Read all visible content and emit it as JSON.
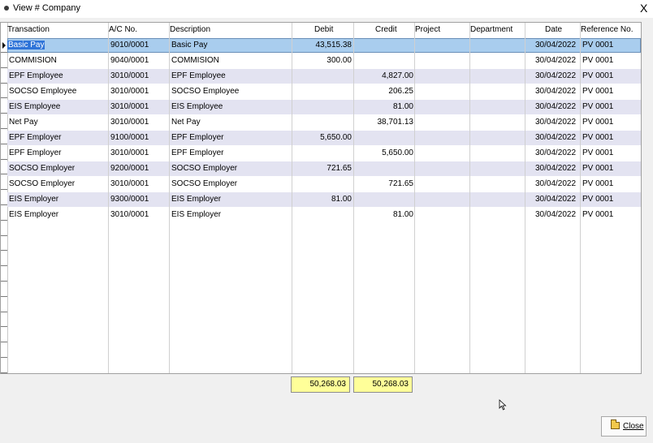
{
  "window": {
    "title": "View # Company",
    "close_glyph": "X"
  },
  "table": {
    "columns": [
      "Transaction",
      "A/C No.",
      "Description",
      "Debit",
      "Credit",
      "Project",
      "Department",
      "Date",
      "Reference No."
    ],
    "rows": [
      {
        "transaction": "Basic Pay",
        "ac_no": "9010/0001",
        "description": "Basic Pay",
        "debit": "43,515.38",
        "credit": "",
        "project": "",
        "department": "",
        "date": "30/04/2022",
        "ref": "PV 0001"
      },
      {
        "transaction": "COMMISION",
        "ac_no": "9040/0001",
        "description": "COMMISION",
        "debit": "300.00",
        "credit": "",
        "project": "",
        "department": "",
        "date": "30/04/2022",
        "ref": "PV 0001"
      },
      {
        "transaction": "EPF Employee",
        "ac_no": "3010/0001",
        "description": "EPF Employee",
        "debit": "",
        "credit": "4,827.00",
        "project": "",
        "department": "",
        "date": "30/04/2022",
        "ref": "PV 0001"
      },
      {
        "transaction": "SOCSO Employee",
        "ac_no": "3010/0001",
        "description": "SOCSO Employee",
        "debit": "",
        "credit": "206.25",
        "project": "",
        "department": "",
        "date": "30/04/2022",
        "ref": "PV 0001"
      },
      {
        "transaction": "EIS Employee",
        "ac_no": "3010/0001",
        "description": "EIS Employee",
        "debit": "",
        "credit": "81.00",
        "project": "",
        "department": "",
        "date": "30/04/2022",
        "ref": "PV 0001"
      },
      {
        "transaction": "Net Pay",
        "ac_no": "3010/0001",
        "description": "Net Pay",
        "debit": "",
        "credit": "38,701.13",
        "project": "",
        "department": "",
        "date": "30/04/2022",
        "ref": "PV 0001"
      },
      {
        "transaction": "EPF Employer",
        "ac_no": "9100/0001",
        "description": "EPF Employer",
        "debit": "5,650.00",
        "credit": "",
        "project": "",
        "department": "",
        "date": "30/04/2022",
        "ref": "PV 0001"
      },
      {
        "transaction": "EPF Employer",
        "ac_no": "3010/0001",
        "description": "EPF Employer",
        "debit": "",
        "credit": "5,650.00",
        "project": "",
        "department": "",
        "date": "30/04/2022",
        "ref": "PV 0001"
      },
      {
        "transaction": "SOCSO Employer",
        "ac_no": "9200/0001",
        "description": "SOCSO Employer",
        "debit": "721.65",
        "credit": "",
        "project": "",
        "department": "",
        "date": "30/04/2022",
        "ref": "PV 0001"
      },
      {
        "transaction": "SOCSO Employer",
        "ac_no": "3010/0001",
        "description": "SOCSO Employer",
        "debit": "",
        "credit": "721.65",
        "project": "",
        "department": "",
        "date": "30/04/2022",
        "ref": "PV 0001"
      },
      {
        "transaction": "EIS Employer",
        "ac_no": "9300/0001",
        "description": "EIS Employer",
        "debit": "81.00",
        "credit": "",
        "project": "",
        "department": "",
        "date": "30/04/2022",
        "ref": "PV 0001"
      },
      {
        "transaction": "EIS Employer",
        "ac_no": "3010/0001",
        "description": "EIS Employer",
        "debit": "",
        "credit": "81.00",
        "project": "",
        "department": "",
        "date": "30/04/2022",
        "ref": "PV 0001"
      }
    ],
    "selected_row": 0
  },
  "totals": {
    "debit": "50,268.03",
    "credit": "50,268.03"
  },
  "buttons": {
    "close_label": "Close"
  },
  "colors": {
    "selected_row": "#a9cdee",
    "alt_row": "#e3e3f1",
    "total_bg": "#ffff99",
    "cell_selected": "#2f74d8"
  }
}
